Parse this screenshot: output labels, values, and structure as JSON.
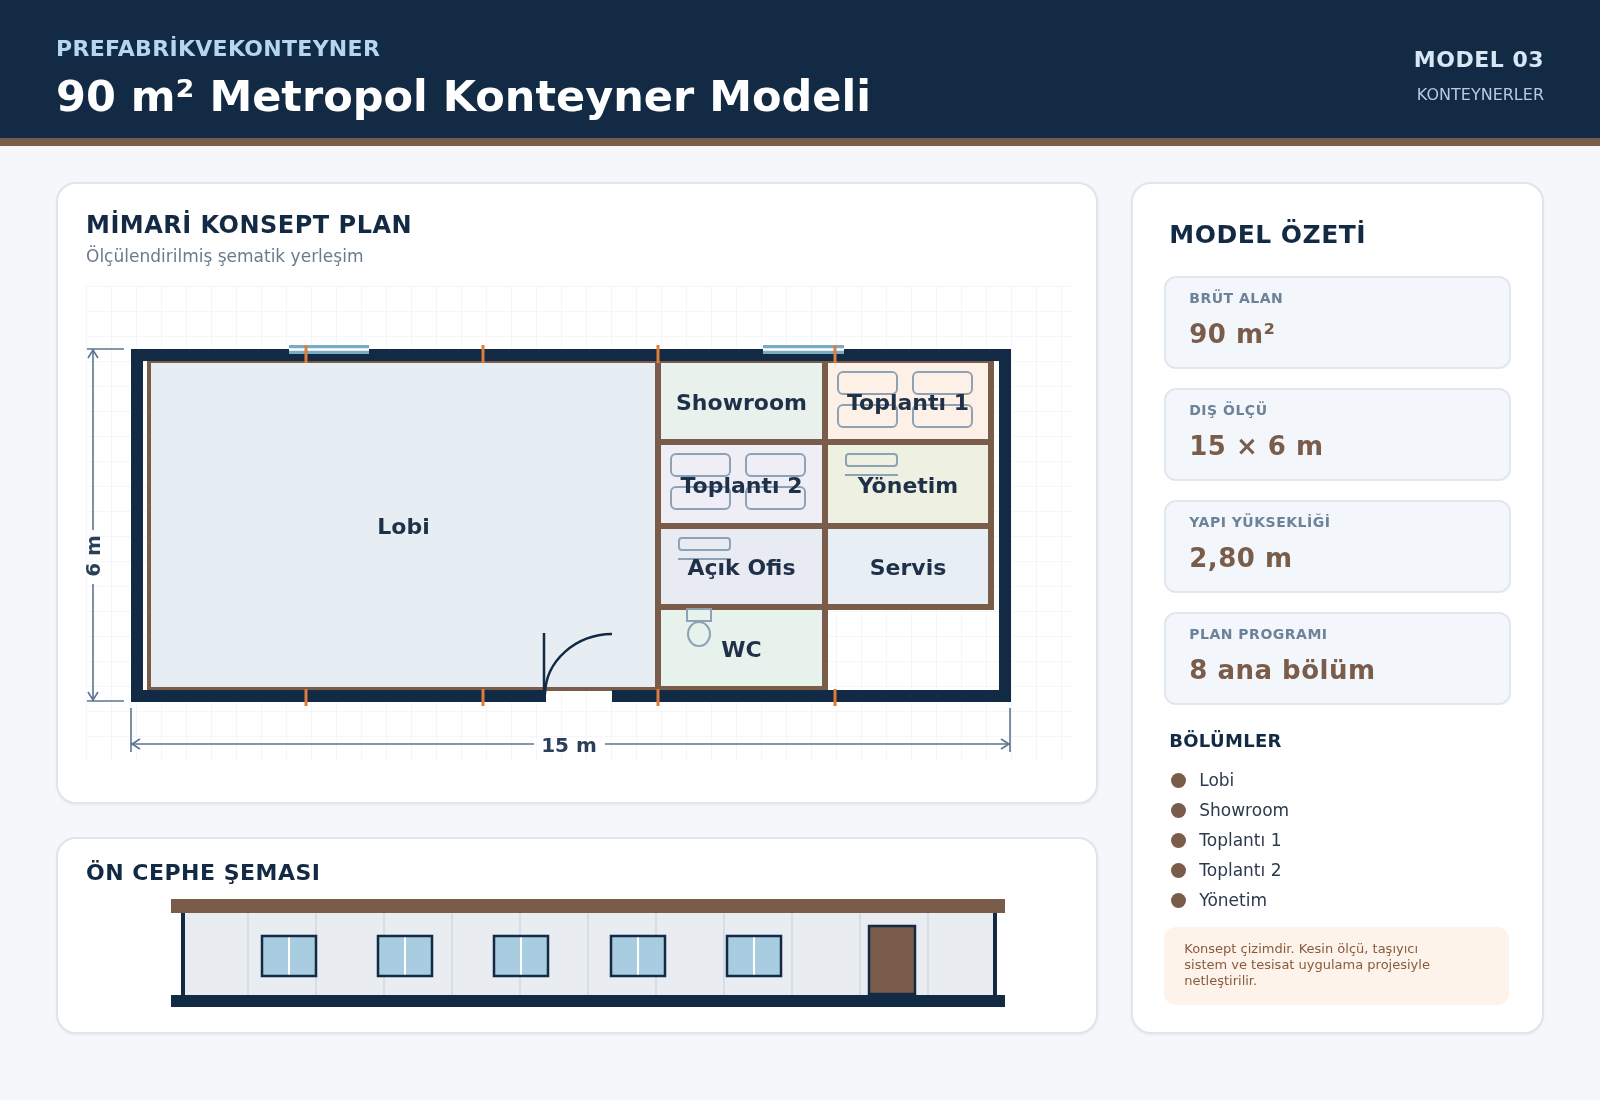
{
  "header": {
    "brand": "PREFABRİKVEKONTEYNER",
    "title": "90 m² Metropol Konteyner Modeli",
    "model": "MODEL 03",
    "category": "KONTEYNERLER"
  },
  "plan_card": {
    "title": "MİMARİ KONSEPT PLAN",
    "subtitle": "Ölçülendirilmiş şematik yerleşim",
    "rooms": [
      {
        "label": "Lobi",
        "kind": "plain",
        "color": "#e6eef4"
      },
      {
        "label": "Showroom",
        "kind": "plain",
        "color": "#e8f1ec"
      },
      {
        "label": "Toplantı 1",
        "kind": "meeting",
        "color": "#fdf1e7"
      },
      {
        "label": "Toplantı 2",
        "kind": "meeting",
        "color": "#efedf6"
      },
      {
        "label": "Yönetim",
        "kind": "desk",
        "color": "#eef1e1"
      },
      {
        "label": "Açık Ofis",
        "kind": "desk",
        "color": "#e9ebf3"
      },
      {
        "label": "Servis",
        "kind": "plain",
        "color": "#e7eff4"
      },
      {
        "label": "WC",
        "kind": "toilet",
        "color": "#e8f2ec"
      }
    ],
    "height_label": "6 m",
    "width_label": "15 m"
  },
  "facade_card": {
    "title": "ÖN CEPHE ŞEMASI"
  },
  "summary": {
    "title": "MODEL ÖZETİ",
    "stats": [
      {
        "label": "BRÜT ALAN",
        "value": "90 m²"
      },
      {
        "label": "DIŞ ÖLÇÜ",
        "value": "15 × 6 m"
      },
      {
        "label": "YAPI YÜKSEKLİĞİ",
        "value": "2,80 m"
      },
      {
        "label": "PLAN PROGRAMI",
        "value": "8 ana bölüm"
      }
    ],
    "sections_title": "BÖLÜMLER",
    "sections": [
      "Lobi",
      "Showroom",
      "Toplantı 1",
      "Toplantı 2",
      "Yönetim"
    ],
    "note": "Konsept çizimdir. Kesin ölçü, taşıyıcı sistem ve tesisat uygulama projesiyle netleştirilir."
  }
}
